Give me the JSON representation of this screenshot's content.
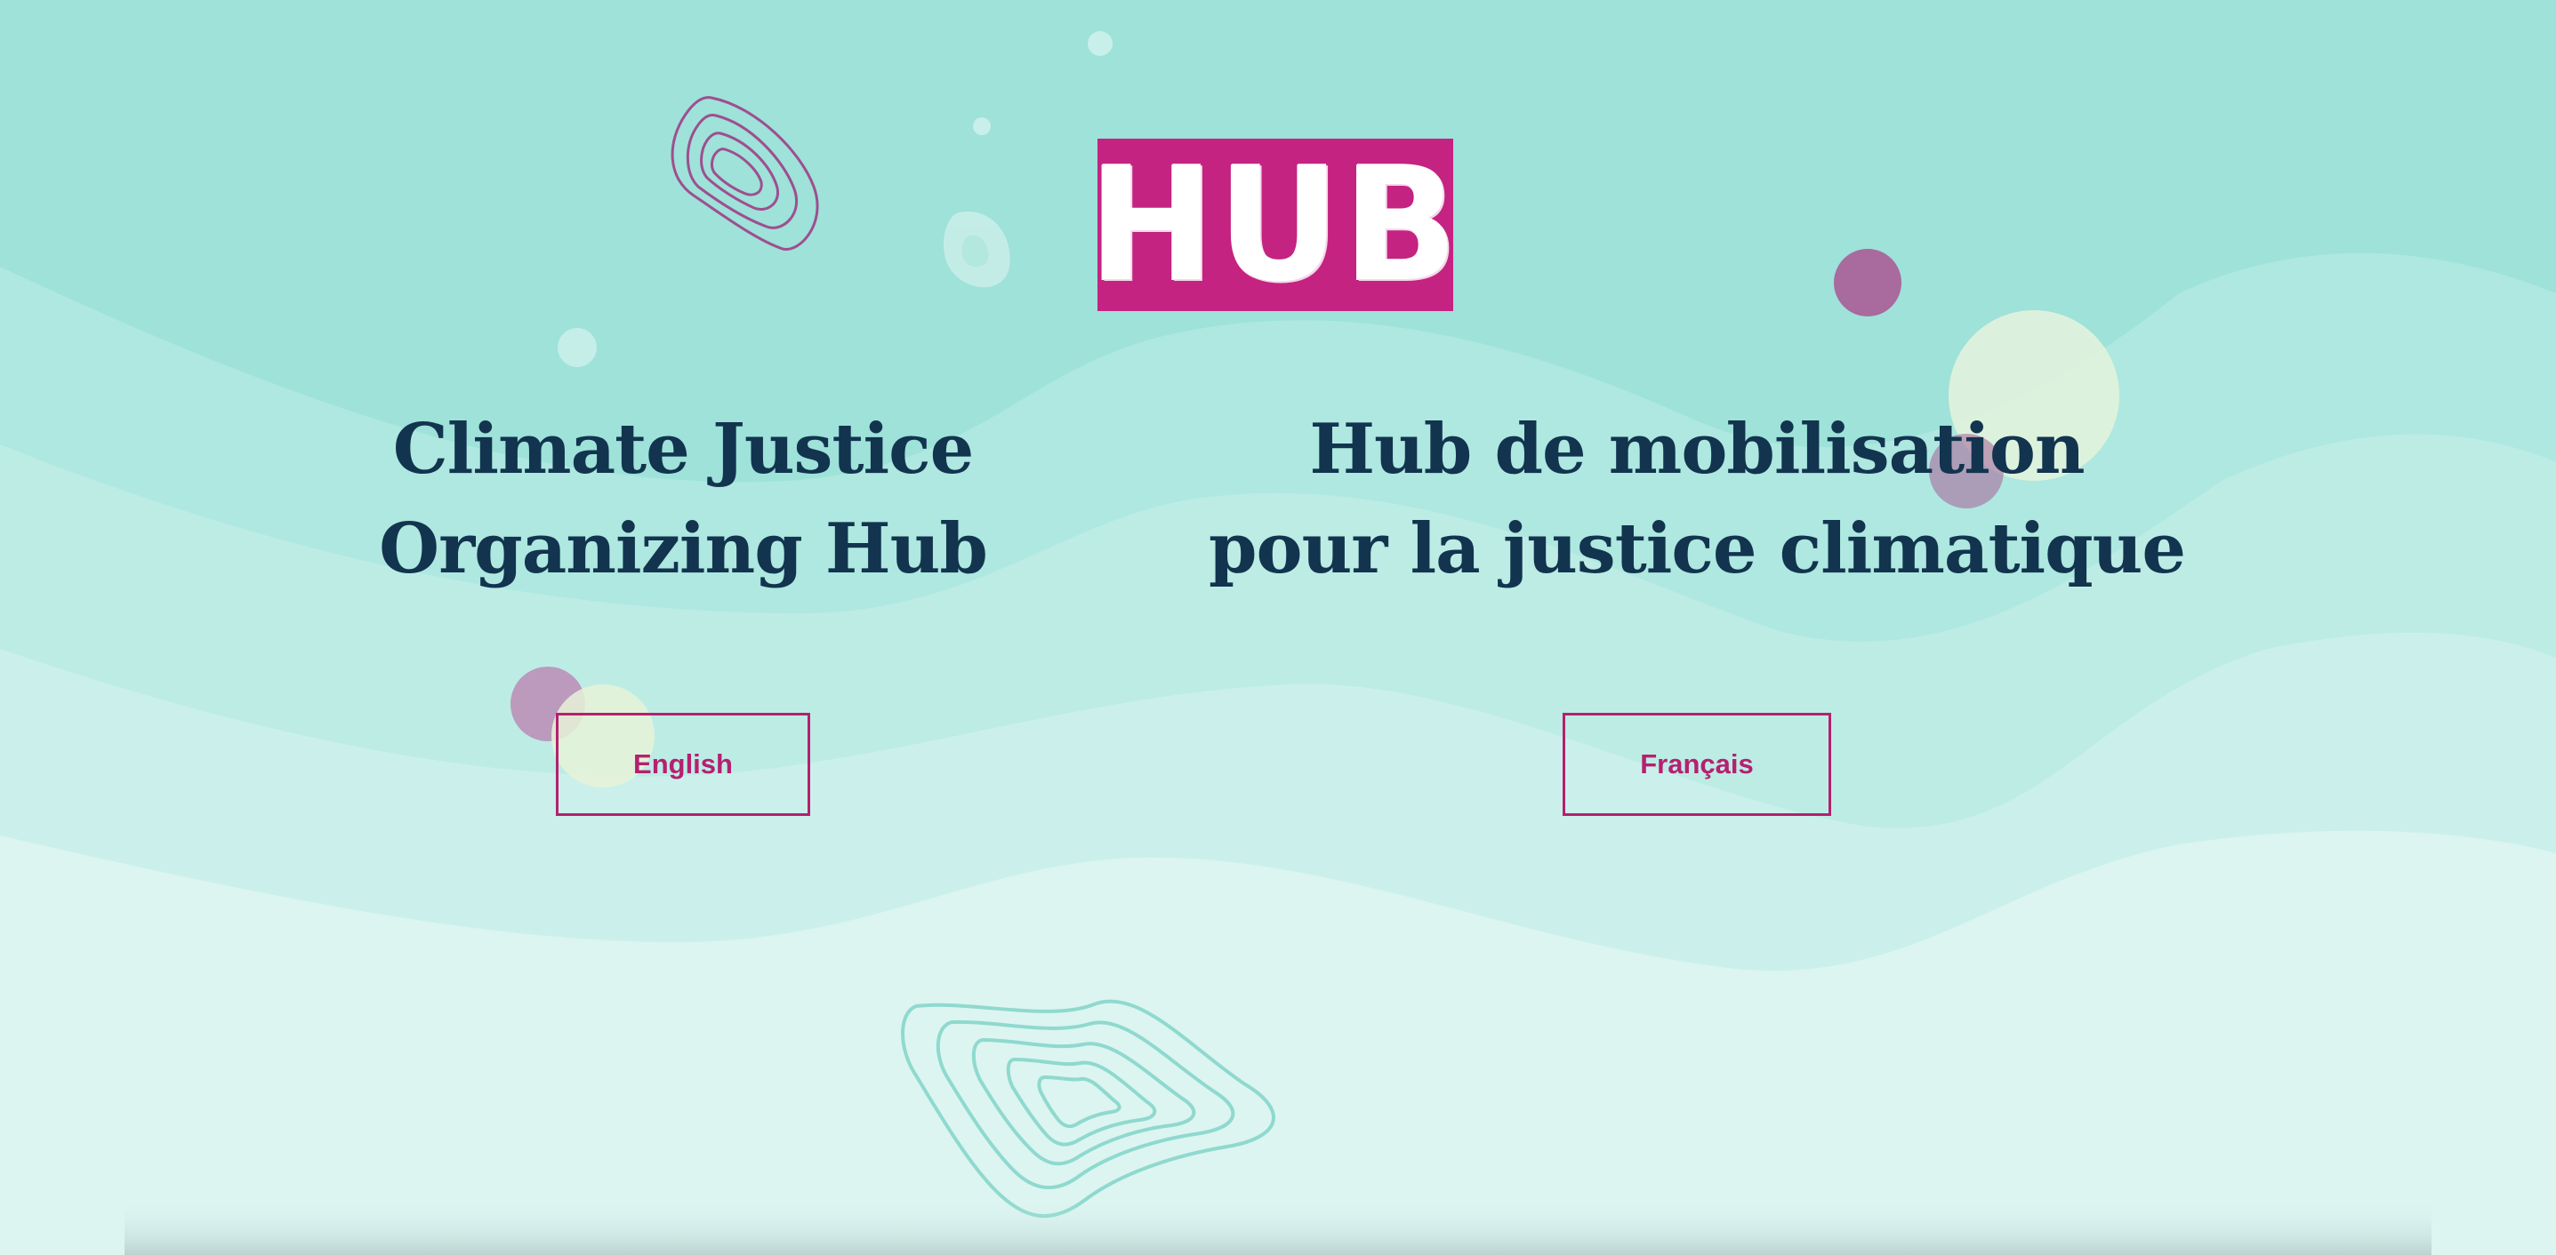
{
  "logo": {
    "text": "HUB",
    "color": "#c42382"
  },
  "english": {
    "title_line1": "Climate Justice",
    "title_line2": "Organizing Hub",
    "button_label": "English"
  },
  "french": {
    "title_line1": "Hub de mobilisation",
    "title_line2": "pour la justice climatique",
    "button_label": "Français"
  },
  "colors": {
    "background": "#9ee2d9",
    "heading": "#12344f",
    "accent": "#b5206f"
  }
}
